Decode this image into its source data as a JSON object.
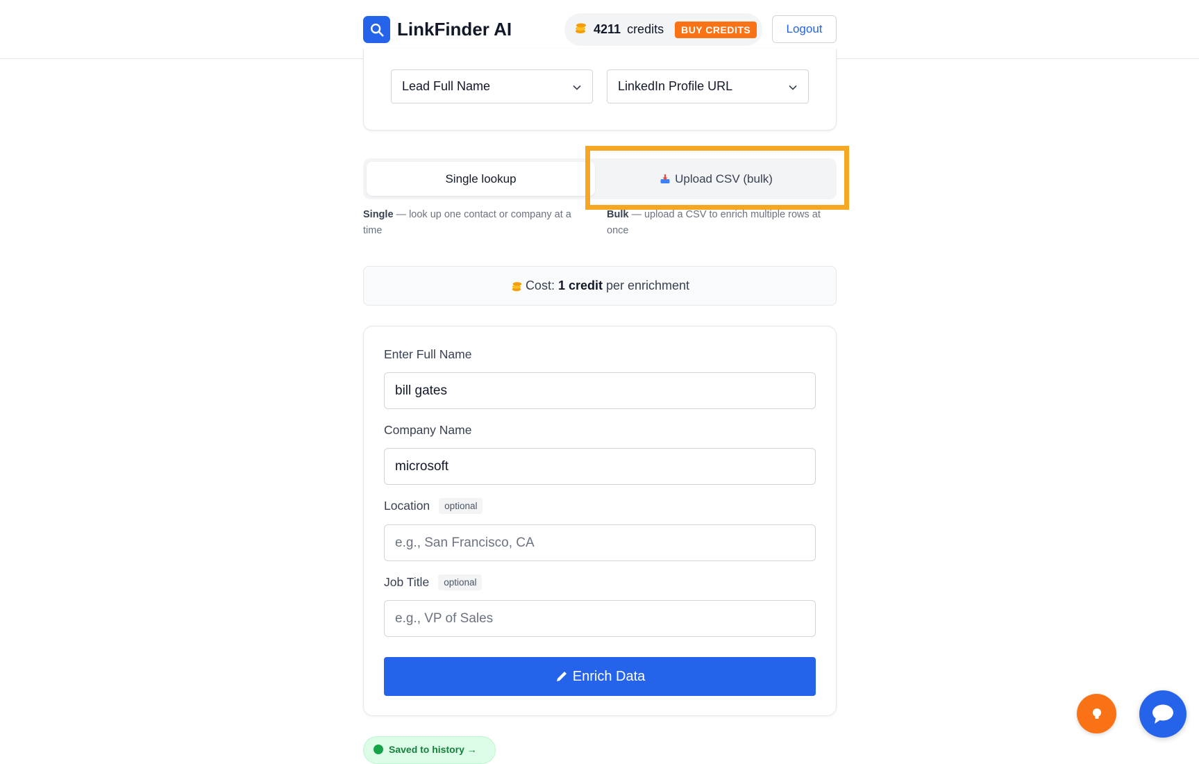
{
  "header": {
    "brand_name": "LinkFinder AI",
    "credits_count": "4211",
    "credits_word": "credits",
    "buy_label": "BUY CREDITS",
    "logout_label": "Logout"
  },
  "selectors": {
    "input_type": "Lead Full Name",
    "output_type": "LinkedIn Profile URL"
  },
  "tabs": {
    "single_label": "Single lookup",
    "bulk_label": "Upload CSV (bulk)",
    "single_desc_bold": "Single",
    "single_desc_rest": " — look up one contact or company at a time",
    "bulk_desc_bold": "Bulk",
    "bulk_desc_rest": " — upload a CSV to enrich multiple rows at once"
  },
  "cost": {
    "prefix": "Cost:",
    "amount": "1 credit",
    "suffix": "per enrichment"
  },
  "form": {
    "full_name_label": "Enter Full Name",
    "full_name_value": "bill gates",
    "company_label": "Company Name",
    "company_value": "microsoft",
    "location_label": "Location",
    "location_badge": "optional",
    "location_placeholder": "e.g., San Francisco, CA",
    "job_title_label": "Job Title",
    "job_title_badge": "optional",
    "job_title_placeholder": "e.g., VP of Sales",
    "submit_label": "Enrich Data"
  },
  "history": {
    "saved_label": "Saved to history →"
  },
  "colors": {
    "primary": "#2563eb",
    "accent": "#f97316",
    "highlight": "#f5a623",
    "success": "#15803d"
  },
  "icons": [
    "search-icon",
    "coins-icon",
    "chevron-down-icon",
    "inbox-tray-icon",
    "pencil-icon",
    "check-circle-icon",
    "lightbulb-icon",
    "chat-bubble-icon"
  ]
}
